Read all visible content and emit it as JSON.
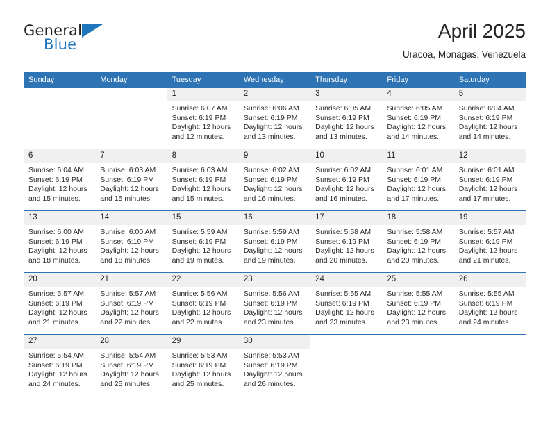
{
  "brand": {
    "name_top": "General",
    "name_bottom": "Blue",
    "triangle_icon": "triangle-icon",
    "colors": {
      "blue": "#1f76bc",
      "dark": "#231f20"
    }
  },
  "header": {
    "title": "April 2025",
    "subtitle": "Uracoa, Monagas, Venezuela"
  },
  "theme": {
    "header_blue": "#2e74b5",
    "daynum_gray": "#f0f0f0",
    "text": "#222222"
  },
  "weekday_headers": [
    "Sunday",
    "Monday",
    "Tuesday",
    "Wednesday",
    "Thursday",
    "Friday",
    "Saturday"
  ],
  "weeks": [
    [
      {
        "day": "",
        "sunrise": "",
        "sunset": "",
        "daylight_a": "",
        "daylight_b": ""
      },
      {
        "day": "",
        "sunrise": "",
        "sunset": "",
        "daylight_a": "",
        "daylight_b": ""
      },
      {
        "day": "1",
        "sunrise": "Sunrise: 6:07 AM",
        "sunset": "Sunset: 6:19 PM",
        "daylight_a": "Daylight: 12 hours",
        "daylight_b": "and 12 minutes."
      },
      {
        "day": "2",
        "sunrise": "Sunrise: 6:06 AM",
        "sunset": "Sunset: 6:19 PM",
        "daylight_a": "Daylight: 12 hours",
        "daylight_b": "and 13 minutes."
      },
      {
        "day": "3",
        "sunrise": "Sunrise: 6:05 AM",
        "sunset": "Sunset: 6:19 PM",
        "daylight_a": "Daylight: 12 hours",
        "daylight_b": "and 13 minutes."
      },
      {
        "day": "4",
        "sunrise": "Sunrise: 6:05 AM",
        "sunset": "Sunset: 6:19 PM",
        "daylight_a": "Daylight: 12 hours",
        "daylight_b": "and 14 minutes."
      },
      {
        "day": "5",
        "sunrise": "Sunrise: 6:04 AM",
        "sunset": "Sunset: 6:19 PM",
        "daylight_a": "Daylight: 12 hours",
        "daylight_b": "and 14 minutes."
      }
    ],
    [
      {
        "day": "6",
        "sunrise": "Sunrise: 6:04 AM",
        "sunset": "Sunset: 6:19 PM",
        "daylight_a": "Daylight: 12 hours",
        "daylight_b": "and 15 minutes."
      },
      {
        "day": "7",
        "sunrise": "Sunrise: 6:03 AM",
        "sunset": "Sunset: 6:19 PM",
        "daylight_a": "Daylight: 12 hours",
        "daylight_b": "and 15 minutes."
      },
      {
        "day": "8",
        "sunrise": "Sunrise: 6:03 AM",
        "sunset": "Sunset: 6:19 PM",
        "daylight_a": "Daylight: 12 hours",
        "daylight_b": "and 15 minutes."
      },
      {
        "day": "9",
        "sunrise": "Sunrise: 6:02 AM",
        "sunset": "Sunset: 6:19 PM",
        "daylight_a": "Daylight: 12 hours",
        "daylight_b": "and 16 minutes."
      },
      {
        "day": "10",
        "sunrise": "Sunrise: 6:02 AM",
        "sunset": "Sunset: 6:19 PM",
        "daylight_a": "Daylight: 12 hours",
        "daylight_b": "and 16 minutes."
      },
      {
        "day": "11",
        "sunrise": "Sunrise: 6:01 AM",
        "sunset": "Sunset: 6:19 PM",
        "daylight_a": "Daylight: 12 hours",
        "daylight_b": "and 17 minutes."
      },
      {
        "day": "12",
        "sunrise": "Sunrise: 6:01 AM",
        "sunset": "Sunset: 6:19 PM",
        "daylight_a": "Daylight: 12 hours",
        "daylight_b": "and 17 minutes."
      }
    ],
    [
      {
        "day": "13",
        "sunrise": "Sunrise: 6:00 AM",
        "sunset": "Sunset: 6:19 PM",
        "daylight_a": "Daylight: 12 hours",
        "daylight_b": "and 18 minutes."
      },
      {
        "day": "14",
        "sunrise": "Sunrise: 6:00 AM",
        "sunset": "Sunset: 6:19 PM",
        "daylight_a": "Daylight: 12 hours",
        "daylight_b": "and 18 minutes."
      },
      {
        "day": "15",
        "sunrise": "Sunrise: 5:59 AM",
        "sunset": "Sunset: 6:19 PM",
        "daylight_a": "Daylight: 12 hours",
        "daylight_b": "and 19 minutes."
      },
      {
        "day": "16",
        "sunrise": "Sunrise: 5:59 AM",
        "sunset": "Sunset: 6:19 PM",
        "daylight_a": "Daylight: 12 hours",
        "daylight_b": "and 19 minutes."
      },
      {
        "day": "17",
        "sunrise": "Sunrise: 5:58 AM",
        "sunset": "Sunset: 6:19 PM",
        "daylight_a": "Daylight: 12 hours",
        "daylight_b": "and 20 minutes."
      },
      {
        "day": "18",
        "sunrise": "Sunrise: 5:58 AM",
        "sunset": "Sunset: 6:19 PM",
        "daylight_a": "Daylight: 12 hours",
        "daylight_b": "and 20 minutes."
      },
      {
        "day": "19",
        "sunrise": "Sunrise: 5:57 AM",
        "sunset": "Sunset: 6:19 PM",
        "daylight_a": "Daylight: 12 hours",
        "daylight_b": "and 21 minutes."
      }
    ],
    [
      {
        "day": "20",
        "sunrise": "Sunrise: 5:57 AM",
        "sunset": "Sunset: 6:19 PM",
        "daylight_a": "Daylight: 12 hours",
        "daylight_b": "and 21 minutes."
      },
      {
        "day": "21",
        "sunrise": "Sunrise: 5:57 AM",
        "sunset": "Sunset: 6:19 PM",
        "daylight_a": "Daylight: 12 hours",
        "daylight_b": "and 22 minutes."
      },
      {
        "day": "22",
        "sunrise": "Sunrise: 5:56 AM",
        "sunset": "Sunset: 6:19 PM",
        "daylight_a": "Daylight: 12 hours",
        "daylight_b": "and 22 minutes."
      },
      {
        "day": "23",
        "sunrise": "Sunrise: 5:56 AM",
        "sunset": "Sunset: 6:19 PM",
        "daylight_a": "Daylight: 12 hours",
        "daylight_b": "and 23 minutes."
      },
      {
        "day": "24",
        "sunrise": "Sunrise: 5:55 AM",
        "sunset": "Sunset: 6:19 PM",
        "daylight_a": "Daylight: 12 hours",
        "daylight_b": "and 23 minutes."
      },
      {
        "day": "25",
        "sunrise": "Sunrise: 5:55 AM",
        "sunset": "Sunset: 6:19 PM",
        "daylight_a": "Daylight: 12 hours",
        "daylight_b": "and 23 minutes."
      },
      {
        "day": "26",
        "sunrise": "Sunrise: 5:55 AM",
        "sunset": "Sunset: 6:19 PM",
        "daylight_a": "Daylight: 12 hours",
        "daylight_b": "and 24 minutes."
      }
    ],
    [
      {
        "day": "27",
        "sunrise": "Sunrise: 5:54 AM",
        "sunset": "Sunset: 6:19 PM",
        "daylight_a": "Daylight: 12 hours",
        "daylight_b": "and 24 minutes."
      },
      {
        "day": "28",
        "sunrise": "Sunrise: 5:54 AM",
        "sunset": "Sunset: 6:19 PM",
        "daylight_a": "Daylight: 12 hours",
        "daylight_b": "and 25 minutes."
      },
      {
        "day": "29",
        "sunrise": "Sunrise: 5:53 AM",
        "sunset": "Sunset: 6:19 PM",
        "daylight_a": "Daylight: 12 hours",
        "daylight_b": "and 25 minutes."
      },
      {
        "day": "30",
        "sunrise": "Sunrise: 5:53 AM",
        "sunset": "Sunset: 6:19 PM",
        "daylight_a": "Daylight: 12 hours",
        "daylight_b": "and 26 minutes."
      },
      {
        "day": "",
        "sunrise": "",
        "sunset": "",
        "daylight_a": "",
        "daylight_b": ""
      },
      {
        "day": "",
        "sunrise": "",
        "sunset": "",
        "daylight_a": "",
        "daylight_b": ""
      },
      {
        "day": "",
        "sunrise": "",
        "sunset": "",
        "daylight_a": "",
        "daylight_b": ""
      }
    ]
  ]
}
